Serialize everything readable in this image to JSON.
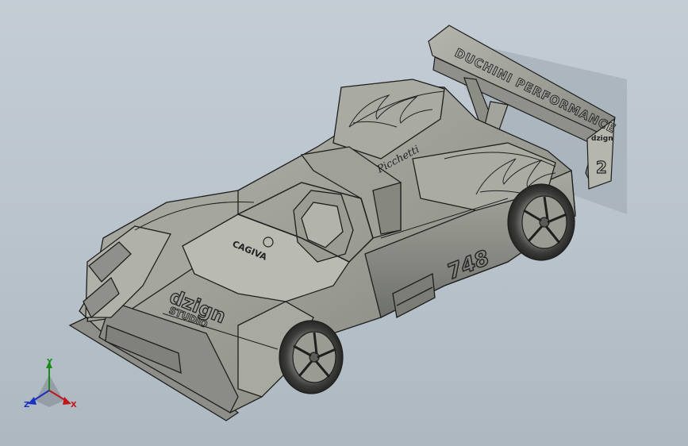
{
  "viewport": {
    "background_top": "#c4cdd5",
    "background_bottom": "#aeb8c1",
    "model_color": "#9a9c94",
    "edge_color": "#1e1e1c"
  },
  "decals": {
    "wing_text": "DUCHINI PERFORMANCE",
    "wing_badge": "2",
    "wing_logo": "dzign",
    "race_number": "48",
    "hood_brand": "CAGIVA",
    "front_logo": "dzign",
    "front_sub": "STUDIO",
    "cockpit_script": "Picchetti"
  },
  "triad": {
    "axes": [
      {
        "name": "Y",
        "color": "#1a8a1a"
      },
      {
        "name": "X",
        "color": "#c01818"
      },
      {
        "name": "Z",
        "color": "#1a30c0"
      }
    ]
  }
}
